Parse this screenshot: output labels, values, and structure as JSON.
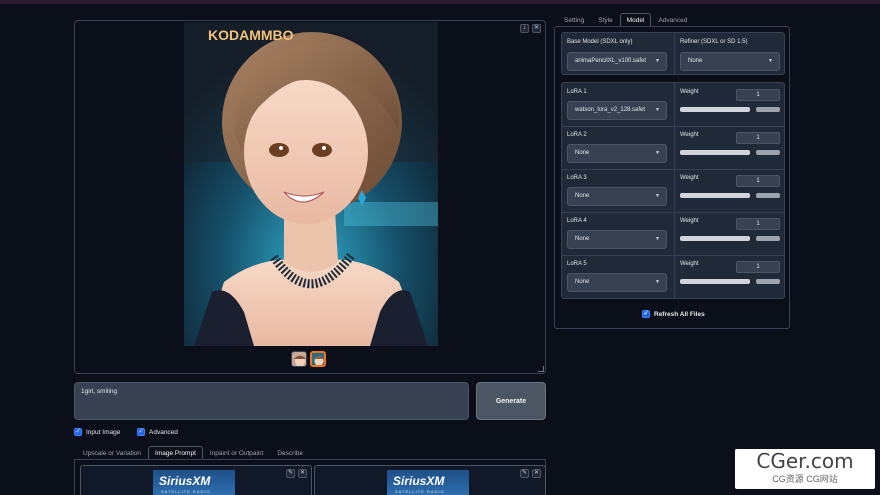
{
  "gallery": {
    "image_logo": "KODAMMBO",
    "tools": [
      "↓",
      "✕"
    ]
  },
  "prompt": {
    "value": "1girl, smiling"
  },
  "generate_label": "Generate",
  "checkboxes": {
    "input_image": "Input Image",
    "advanced": "Advanced"
  },
  "bottom_tabs": [
    "Upscale or Variation",
    "Image Prompt",
    "Inpaint or Outpaint",
    "Describe"
  ],
  "image_prompt": {
    "logo": "SiriusXM",
    "sub": "SATELLITE RADIO",
    "tools": [
      "✎",
      "✕"
    ]
  },
  "right_tabs": [
    "Setting",
    "Style",
    "Model",
    "Advanced"
  ],
  "model": {
    "base_label": "Base Model (SDXL only)",
    "base_value": "animaPencilXL_v100.safet",
    "refiner_label": "Refiner (SDXL or SD 1.5)",
    "refiner_value": "None",
    "weight_label": "Weight",
    "loras": [
      {
        "label": "LoRA 1",
        "value": "watson_lora_v2_128.safet",
        "weight": "1"
      },
      {
        "label": "LoRA 2",
        "value": "None",
        "weight": "1"
      },
      {
        "label": "LoRA 3",
        "value": "None",
        "weight": "1"
      },
      {
        "label": "LoRA 4",
        "value": "None",
        "weight": "1"
      },
      {
        "label": "LoRA 5",
        "value": "None",
        "weight": "1"
      }
    ],
    "refresh_label": "Refresh All Files"
  },
  "watermark": {
    "main": "CGer.com",
    "sub": "CG资源 CG网站"
  },
  "colors": {
    "accent": "#2563eb",
    "selected_thumb": "#f97316",
    "background": "#0b0f19"
  }
}
